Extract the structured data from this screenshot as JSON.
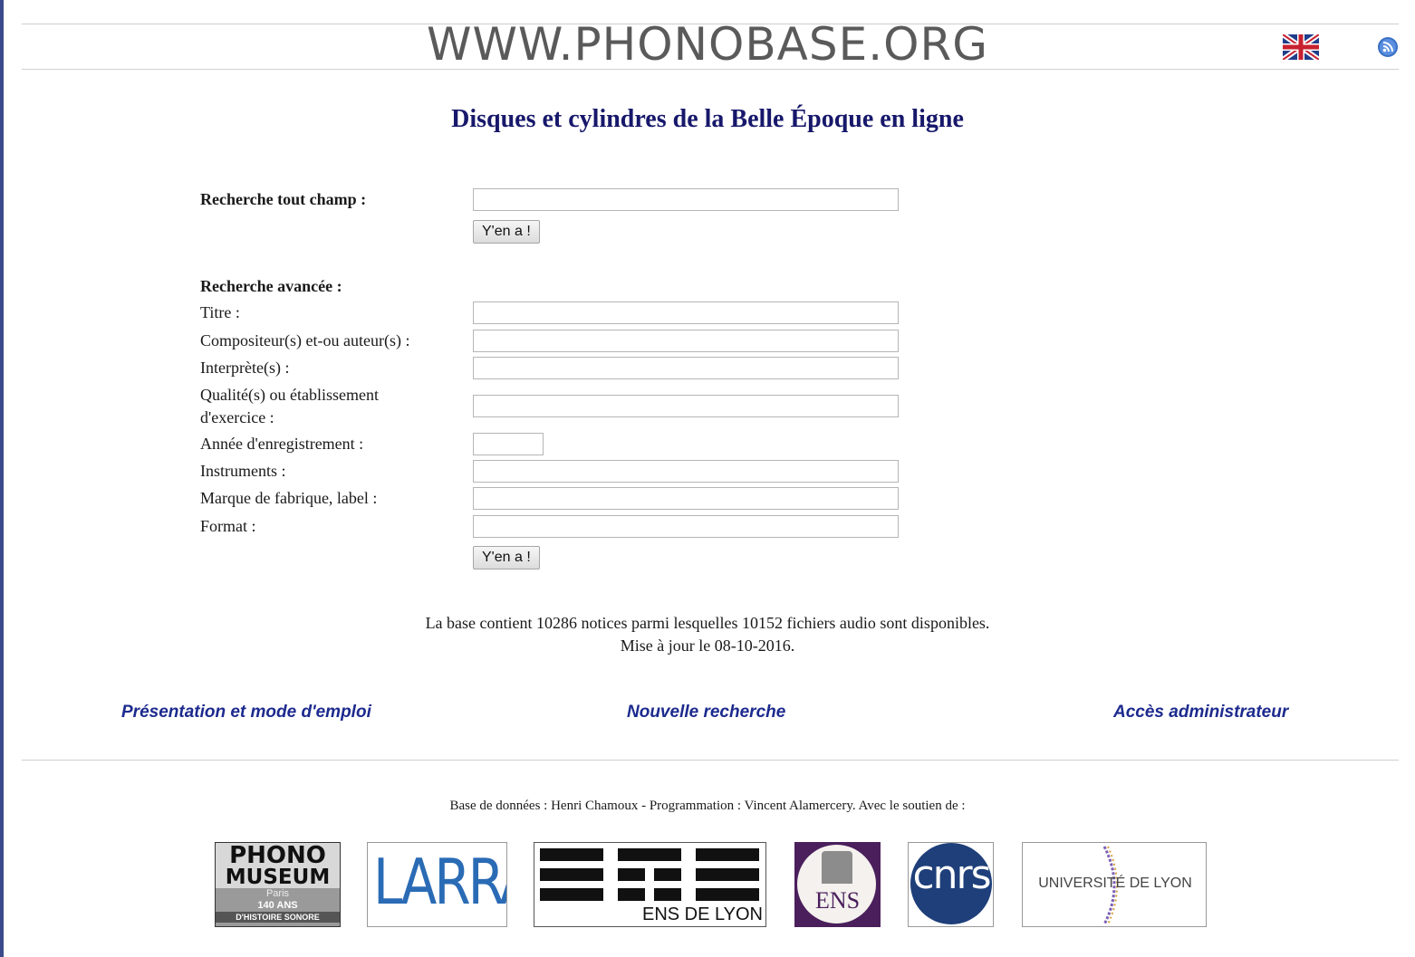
{
  "header": {
    "site_title": "WWW.PHONOBASE.ORG",
    "language_icon": "uk-flag-icon",
    "feed_icon": "rss-icon"
  },
  "page_title": "Disques et cylindres de la Belle Époque en ligne",
  "quick_search": {
    "label": "Recherche tout champ :",
    "value": "",
    "button": "Y'en a !"
  },
  "advanced_search": {
    "heading": "Recherche avancée :",
    "fields": {
      "titre": "Titre :",
      "compositeur": "Compositeur(s) et-ou auteur(s) :",
      "interprete": "Interprète(s) :",
      "qualite_1": "Qualité(s) ou établissement",
      "qualite_2": "d'exercice :",
      "annee": "Année d'enregistrement :",
      "instruments": "Instruments :",
      "marque": "Marque de fabrique, label :",
      "format": "Format :"
    },
    "button": "Y'en a !"
  },
  "stats": {
    "line1": "La base contient 10286 notices parmi lesquelles 10152 fichiers audio sont disponibles.",
    "line2": "Mise à jour le 08-10-2016."
  },
  "nav": {
    "presentation": "Présentation et mode d'emploi",
    "nouvelle": "Nouvelle recherche",
    "admin": "Accès administrateur"
  },
  "footer": {
    "credits": "Base de données : Henri Chamoux - Programmation : Vincent Alamercery. Avec le soutien de :",
    "phono_1": "PHONO",
    "phono_2": "MUSEUM",
    "phono_3": "Paris",
    "phono_4": "140 ANS",
    "phono_5": "D'HISTOIRE SONORE",
    "larra": "LARRA",
    "ens_lyon": "ENS DE LYON",
    "ens": "ENS",
    "cnrs": "cnrs",
    "udl": "UNIVERSITÉ DE LYON"
  },
  "colors": {
    "title_blue": "#17186b",
    "link_blue": "#1c2a8e",
    "cnrs_blue": "#1e3f7a",
    "ens_purple": "#4a1f5c"
  }
}
